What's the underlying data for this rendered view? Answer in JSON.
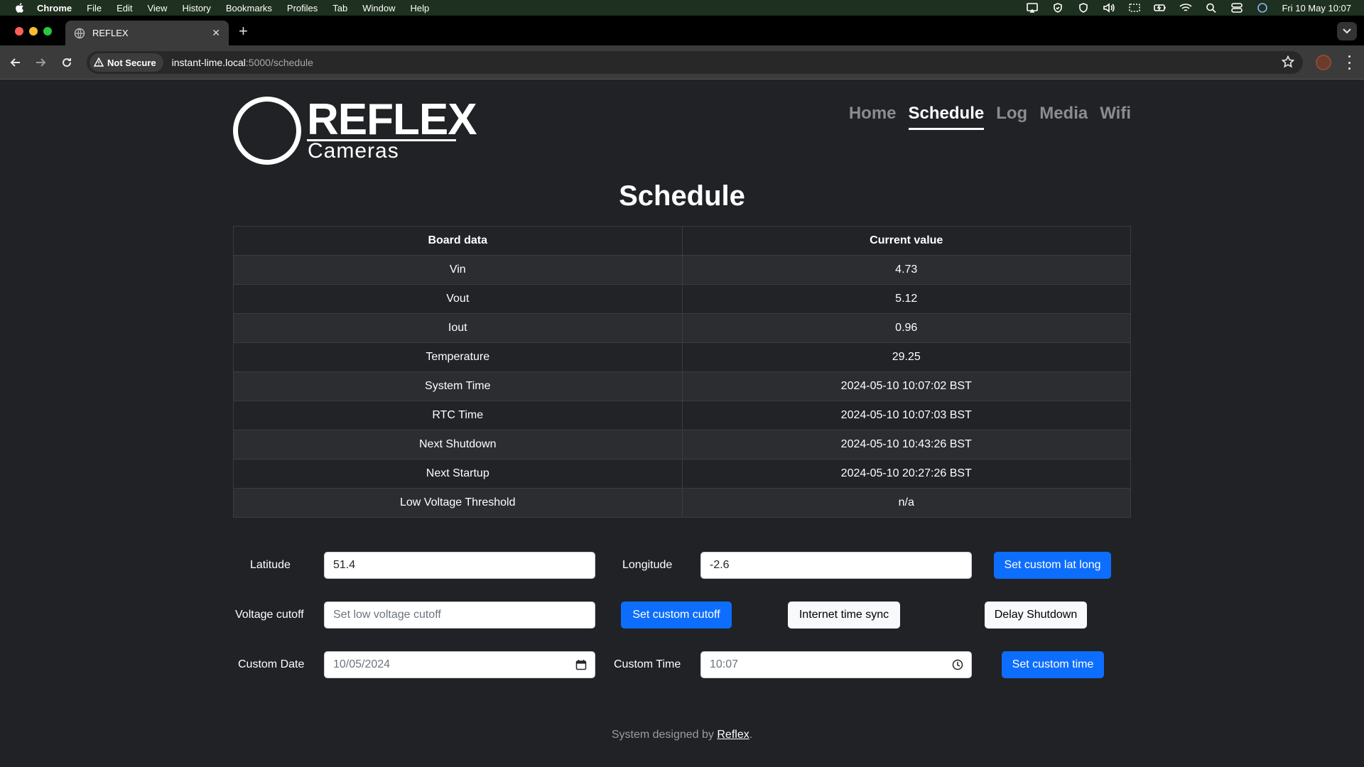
{
  "menubar": {
    "items": [
      "Chrome",
      "File",
      "Edit",
      "View",
      "History",
      "Bookmarks",
      "Profiles",
      "Tab",
      "Window",
      "Help"
    ],
    "clock": "Fri 10 May  10:07"
  },
  "browser": {
    "tab_title": "REFLEX",
    "security_label": "Not Secure",
    "url_host": "instant-lime.local",
    "url_path": ":5000/schedule"
  },
  "logo": {
    "title": "REFLEX",
    "subtitle": "Cameras"
  },
  "nav": [
    {
      "label": "Home",
      "active": false
    },
    {
      "label": "Schedule",
      "active": true
    },
    {
      "label": "Log",
      "active": false
    },
    {
      "label": "Media",
      "active": false
    },
    {
      "label": "Wifi",
      "active": false
    }
  ],
  "page_title": "Schedule",
  "table": {
    "headers": [
      "Board data",
      "Current value"
    ],
    "rows": [
      [
        "Vin",
        "4.73"
      ],
      [
        "Vout",
        "5.12"
      ],
      [
        "Iout",
        "0.96"
      ],
      [
        "Temperature",
        "29.25"
      ],
      [
        "System Time",
        "2024-05-10 10:07:02 BST"
      ],
      [
        "RTC Time",
        "2024-05-10 10:07:03 BST"
      ],
      [
        "Next Shutdown",
        "2024-05-10 10:43:26 BST"
      ],
      [
        "Next Startup",
        "2024-05-10 20:27:26 BST"
      ],
      [
        "Low Voltage Threshold",
        "n/a"
      ]
    ]
  },
  "form": {
    "latitude_label": "Latitude",
    "latitude_value": "51.4",
    "longitude_label": "Longitude",
    "longitude_value": "-2.6",
    "set_latlong_label": "Set custom lat long",
    "voltage_label": "Voltage cutoff",
    "voltage_placeholder": "Set low voltage cutoff",
    "set_cutoff_label": "Set custom cutoff",
    "internet_sync_label": "Internet time sync",
    "delay_shutdown_label": "Delay Shutdown",
    "custom_date_label": "Custom Date",
    "custom_date_value": "10/05/2024",
    "custom_time_label": "Custom Time",
    "custom_time_value": "10:07",
    "set_time_label": "Set custom time"
  },
  "footer": {
    "prefix": "System designed by ",
    "link": "Reflex",
    "suffix": "."
  },
  "colors": {
    "primary": "#0d6efd",
    "page_bg": "#202225",
    "menubar_bg": "#1e301f"
  }
}
